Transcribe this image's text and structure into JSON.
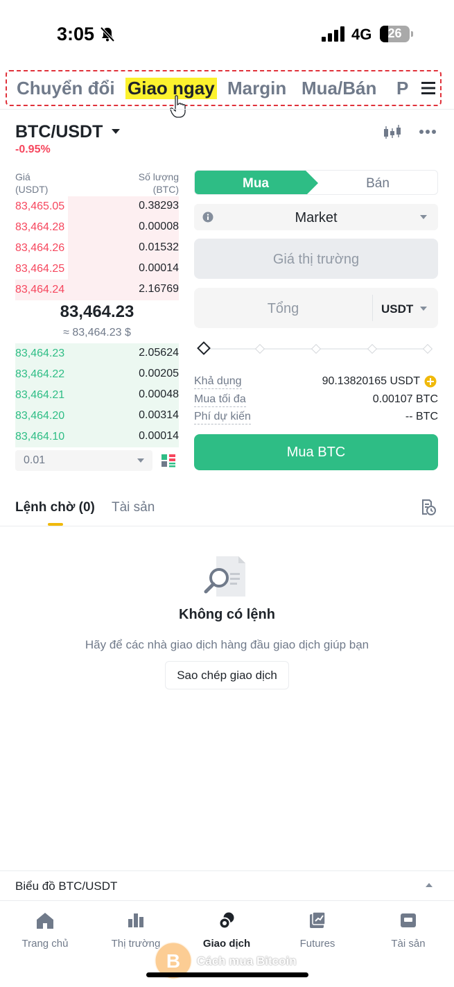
{
  "status_bar": {
    "time": "3:05",
    "network": "4G",
    "battery": "26",
    "icons": [
      "bell-muted-icon",
      "signal-icon",
      "battery-icon"
    ]
  },
  "top_tabs": {
    "items": [
      "Chuyển đổi",
      "Giao ngay",
      "Margin",
      "Mua/Bán",
      "P"
    ],
    "active": "Giao ngay"
  },
  "pair": {
    "symbol": "BTC/USDT",
    "change": "-0.95%"
  },
  "orderbook": {
    "price_header": "Giá",
    "price_unit": "(USDT)",
    "qty_header": "Số lượng",
    "qty_unit": "(BTC)",
    "asks": [
      {
        "price": "83,465.05",
        "qty": "0.38293",
        "depth": 0.68
      },
      {
        "price": "83,464.28",
        "qty": "0.00008",
        "depth": 0.68
      },
      {
        "price": "83,464.26",
        "qty": "0.01532",
        "depth": 0.68
      },
      {
        "price": "83,464.25",
        "qty": "0.00014",
        "depth": 0.68
      },
      {
        "price": "83,464.24",
        "qty": "2.16769",
        "depth": 1.0
      }
    ],
    "last_price": "83,464.23",
    "last_price_fiat": "≈ 83,464.23 $",
    "bids": [
      {
        "price": "83,464.23",
        "qty": "2.05624",
        "depth": 1.0
      },
      {
        "price": "83,464.22",
        "qty": "0.00205",
        "depth": 1.0
      },
      {
        "price": "83,464.21",
        "qty": "0.00048",
        "depth": 1.0
      },
      {
        "price": "83,464.20",
        "qty": "0.00314",
        "depth": 1.0
      },
      {
        "price": "83,464.10",
        "qty": "0.00014",
        "depth": 1.0
      }
    ],
    "depth_step": "0.01"
  },
  "order_form": {
    "buy_label": "Mua",
    "sell_label": "Bán",
    "order_type": "Market",
    "price_placeholder": "Giá thị trường",
    "total_placeholder": "Tổng",
    "total_unit": "USDT",
    "available_label": "Khả dụng",
    "available_value": "90.13820165 USDT",
    "max_buy_label": "Mua tối đa",
    "max_buy_value": "0.00107 BTC",
    "fee_label": "Phí dự kiến",
    "fee_value": "-- BTC",
    "submit_label": "Mua BTC",
    "accent_color": "#2ebd85"
  },
  "orders_tabs": {
    "open_orders": "Lệnh chờ (0)",
    "assets": "Tài sản"
  },
  "empty_state": {
    "title": "Không có lệnh",
    "description": "Hãy để các nhà giao dịch hàng đầu giao dịch giúp bạn",
    "button": "Sao chép giao dịch"
  },
  "chart_bar": {
    "label": "Biểu đồ BTC/USDT"
  },
  "bottom_nav": {
    "items": [
      {
        "label": "Trang chủ",
        "icon": "home-icon"
      },
      {
        "label": "Thị trường",
        "icon": "markets-icon"
      },
      {
        "label": "Giao dịch",
        "icon": "trade-icon"
      },
      {
        "label": "Futures",
        "icon": "futures-icon"
      },
      {
        "label": "Tài sản",
        "icon": "wallet-icon"
      }
    ],
    "active": "Giao dịch"
  },
  "watermark": {
    "text": "Cách mua Bitcoin"
  }
}
